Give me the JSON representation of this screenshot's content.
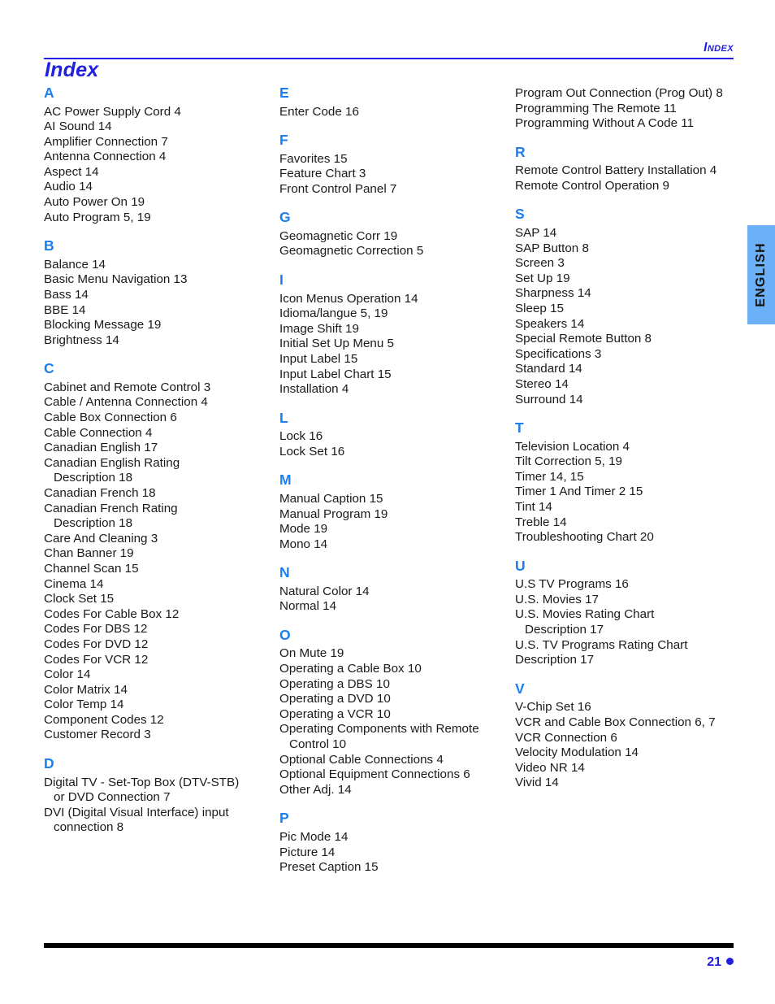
{
  "running_head": "Index",
  "page_title": "Index",
  "side_tab": {
    "label": "ENGLISH"
  },
  "footer": {
    "page_number": "21"
  },
  "colors": {
    "title_blue": "#2020dd",
    "letter_blue": "#1a7ff0",
    "tab_blue": "#6cb0f7",
    "rule_black": "#000000",
    "body_text": "#1a1a1a"
  },
  "columns": [
    {
      "sections": [
        {
          "letter": "A",
          "entries": [
            {
              "text": "AC Power Supply Cord 4",
              "continuation": false
            },
            {
              "text": "AI Sound 14",
              "continuation": false
            },
            {
              "text": "Amplifier Connection 7",
              "continuation": false
            },
            {
              "text": "Antenna Connection 4",
              "continuation": false
            },
            {
              "text": "Aspect 14",
              "continuation": false
            },
            {
              "text": "Audio 14",
              "continuation": false
            },
            {
              "text": "Auto Power On 19",
              "continuation": false
            },
            {
              "text": "Auto Program 5, 19",
              "continuation": false
            }
          ]
        },
        {
          "letter": "B",
          "entries": [
            {
              "text": "Balance 14",
              "continuation": false
            },
            {
              "text": "Basic Menu Navigation 13",
              "continuation": false
            },
            {
              "text": "Bass 14",
              "continuation": false
            },
            {
              "text": "BBE 14",
              "continuation": false
            },
            {
              "text": "Blocking Message 19",
              "continuation": false
            },
            {
              "text": "Brightness 14",
              "continuation": false
            }
          ]
        },
        {
          "letter": "C",
          "entries": [
            {
              "text": "Cabinet and Remote Control 3",
              "continuation": false
            },
            {
              "text": "Cable / Antenna Connection 4",
              "continuation": false
            },
            {
              "text": "Cable Box Connection 6",
              "continuation": false
            },
            {
              "text": "Cable Connection 4",
              "continuation": false
            },
            {
              "text": "Canadian English 17",
              "continuation": false
            },
            {
              "text": "Canadian English Rating",
              "continuation": false
            },
            {
              "text": "Description 18",
              "continuation": true
            },
            {
              "text": "Canadian French 18",
              "continuation": false
            },
            {
              "text": "Canadian French Rating",
              "continuation": false
            },
            {
              "text": "Description 18",
              "continuation": true
            },
            {
              "text": "Care And Cleaning 3",
              "continuation": false
            },
            {
              "text": "Chan Banner 19",
              "continuation": false
            },
            {
              "text": "Channel Scan 15",
              "continuation": false
            },
            {
              "text": "Cinema 14",
              "continuation": false
            },
            {
              "text": "Clock Set 15",
              "continuation": false
            },
            {
              "text": "Codes For Cable Box 12",
              "continuation": false
            },
            {
              "text": "Codes For DBS 12",
              "continuation": false
            },
            {
              "text": "Codes For DVD 12",
              "continuation": false
            },
            {
              "text": "Codes For VCR 12",
              "continuation": false
            },
            {
              "text": "Color 14",
              "continuation": false
            },
            {
              "text": "Color Matrix 14",
              "continuation": false
            },
            {
              "text": "Color Temp 14",
              "continuation": false
            },
            {
              "text": "Component Codes 12",
              "continuation": false
            },
            {
              "text": "Customer Record 3",
              "continuation": false
            }
          ]
        },
        {
          "letter": "D",
          "entries": [
            {
              "text": "Digital TV - Set-Top Box (DTV-STB)",
              "continuation": false
            },
            {
              "text": "or DVD Connection 7",
              "continuation": true
            },
            {
              "text": "DVI (Digital Visual Interface) input",
              "continuation": false
            },
            {
              "text": "connection 8",
              "continuation": true
            }
          ]
        }
      ]
    },
    {
      "sections": [
        {
          "letter": "E",
          "entries": [
            {
              "text": "Enter Code 16",
              "continuation": false
            }
          ]
        },
        {
          "letter": "F",
          "entries": [
            {
              "text": "Favorites 15",
              "continuation": false
            },
            {
              "text": "Feature Chart 3",
              "continuation": false
            },
            {
              "text": "Front Control Panel 7",
              "continuation": false
            }
          ]
        },
        {
          "letter": "G",
          "entries": [
            {
              "text": "Geomagnetic Corr 19",
              "continuation": false
            },
            {
              "text": "Geomagnetic Correction 5",
              "continuation": false
            }
          ]
        },
        {
          "letter": "I",
          "entries": [
            {
              "text": "Icon Menus Operation 14",
              "continuation": false
            },
            {
              "text": "Idioma/langue 5, 19",
              "continuation": false
            },
            {
              "text": "Image Shift 19",
              "continuation": false
            },
            {
              "text": "Initial Set Up Menu 5",
              "continuation": false
            },
            {
              "text": "Input Label 15",
              "continuation": false
            },
            {
              "text": "Input Label Chart 15",
              "continuation": false
            },
            {
              "text": "Installation 4",
              "continuation": false
            }
          ]
        },
        {
          "letter": "L",
          "entries": [
            {
              "text": "Lock 16",
              "continuation": false
            },
            {
              "text": "Lock Set 16",
              "continuation": false
            }
          ]
        },
        {
          "letter": "M",
          "entries": [
            {
              "text": "Manual Caption 15",
              "continuation": false
            },
            {
              "text": "Manual Program 19",
              "continuation": false
            },
            {
              "text": "Mode 19",
              "continuation": false
            },
            {
              "text": "Mono 14",
              "continuation": false
            }
          ]
        },
        {
          "letter": "N",
          "entries": [
            {
              "text": "Natural Color 14",
              "continuation": false
            },
            {
              "text": "Normal 14",
              "continuation": false
            }
          ]
        },
        {
          "letter": "O",
          "entries": [
            {
              "text": "On Mute 19",
              "continuation": false
            },
            {
              "text": "Operating a Cable Box 10",
              "continuation": false
            },
            {
              "text": "Operating a DBS 10",
              "continuation": false
            },
            {
              "text": "Operating a DVD 10",
              "continuation": false
            },
            {
              "text": "Operating a VCR 10",
              "continuation": false
            },
            {
              "text": "Operating Components with Remote",
              "continuation": false
            },
            {
              "text": "Control 10",
              "continuation": true
            },
            {
              "text": "Optional Cable Connections 4",
              "continuation": false
            },
            {
              "text": "Optional Equipment Connections 6",
              "continuation": false
            },
            {
              "text": "Other Adj. 14",
              "continuation": false
            }
          ]
        },
        {
          "letter": "P",
          "entries": [
            {
              "text": "Pic Mode 14",
              "continuation": false
            },
            {
              "text": "Picture 14",
              "continuation": false
            },
            {
              "text": "Preset Caption 15",
              "continuation": false
            }
          ]
        }
      ]
    },
    {
      "sections": [
        {
          "letter": "",
          "entries": [
            {
              "text": "Program Out Connection (Prog Out) 8",
              "continuation": false
            },
            {
              "text": "Programming The Remote 11",
              "continuation": false
            },
            {
              "text": "Programming Without A Code 11",
              "continuation": false
            }
          ]
        },
        {
          "letter": "R",
          "entries": [
            {
              "text": "Remote Control Battery Installation 4",
              "continuation": false
            },
            {
              "text": "Remote Control Operation 9",
              "continuation": false
            }
          ]
        },
        {
          "letter": "S",
          "entries": [
            {
              "text": "SAP 14",
              "continuation": false
            },
            {
              "text": "SAP Button 8",
              "continuation": false
            },
            {
              "text": "Screen 3",
              "continuation": false
            },
            {
              "text": "Set Up 19",
              "continuation": false
            },
            {
              "text": "Sharpness 14",
              "continuation": false
            },
            {
              "text": "Sleep 15",
              "continuation": false
            },
            {
              "text": "Speakers 14",
              "continuation": false
            },
            {
              "text": "Special Remote Button 8",
              "continuation": false
            },
            {
              "text": "Specifications 3",
              "continuation": false
            },
            {
              "text": "Standard 14",
              "continuation": false
            },
            {
              "text": "Stereo 14",
              "continuation": false
            },
            {
              "text": "Surround 14",
              "continuation": false
            }
          ]
        },
        {
          "letter": "T",
          "entries": [
            {
              "text": "Television Location 4",
              "continuation": false
            },
            {
              "text": "Tilt Correction 5, 19",
              "continuation": false
            },
            {
              "text": "Timer 14, 15",
              "continuation": false
            },
            {
              "text": "Timer 1 And Timer 2 15",
              "continuation": false
            },
            {
              "text": "Tint 14",
              "continuation": false
            },
            {
              "text": "Treble 14",
              "continuation": false
            },
            {
              "text": "Troubleshooting Chart 20",
              "continuation": false
            }
          ]
        },
        {
          "letter": "U",
          "entries": [
            {
              "text": "U.S TV Programs 16",
              "continuation": false
            },
            {
              "text": "U.S. Movies 17",
              "continuation": false
            },
            {
              "text": "U.S. Movies Rating Chart",
              "continuation": false
            },
            {
              "text": "Description 17",
              "continuation": true
            },
            {
              "text": "U.S. TV Programs Rating Chart",
              "continuation": false
            },
            {
              "text": "Description 17",
              "continuation": false
            }
          ]
        },
        {
          "letter": "V",
          "entries": [
            {
              "text": "V-Chip Set 16",
              "continuation": false
            },
            {
              "text": "VCR and Cable Box Connection 6, 7",
              "continuation": false
            },
            {
              "text": "VCR Connection 6",
              "continuation": false
            },
            {
              "text": "Velocity Modulation 14",
              "continuation": false
            },
            {
              "text": "Video NR 14",
              "continuation": false
            },
            {
              "text": "Vivid 14",
              "continuation": false
            }
          ]
        }
      ]
    }
  ]
}
